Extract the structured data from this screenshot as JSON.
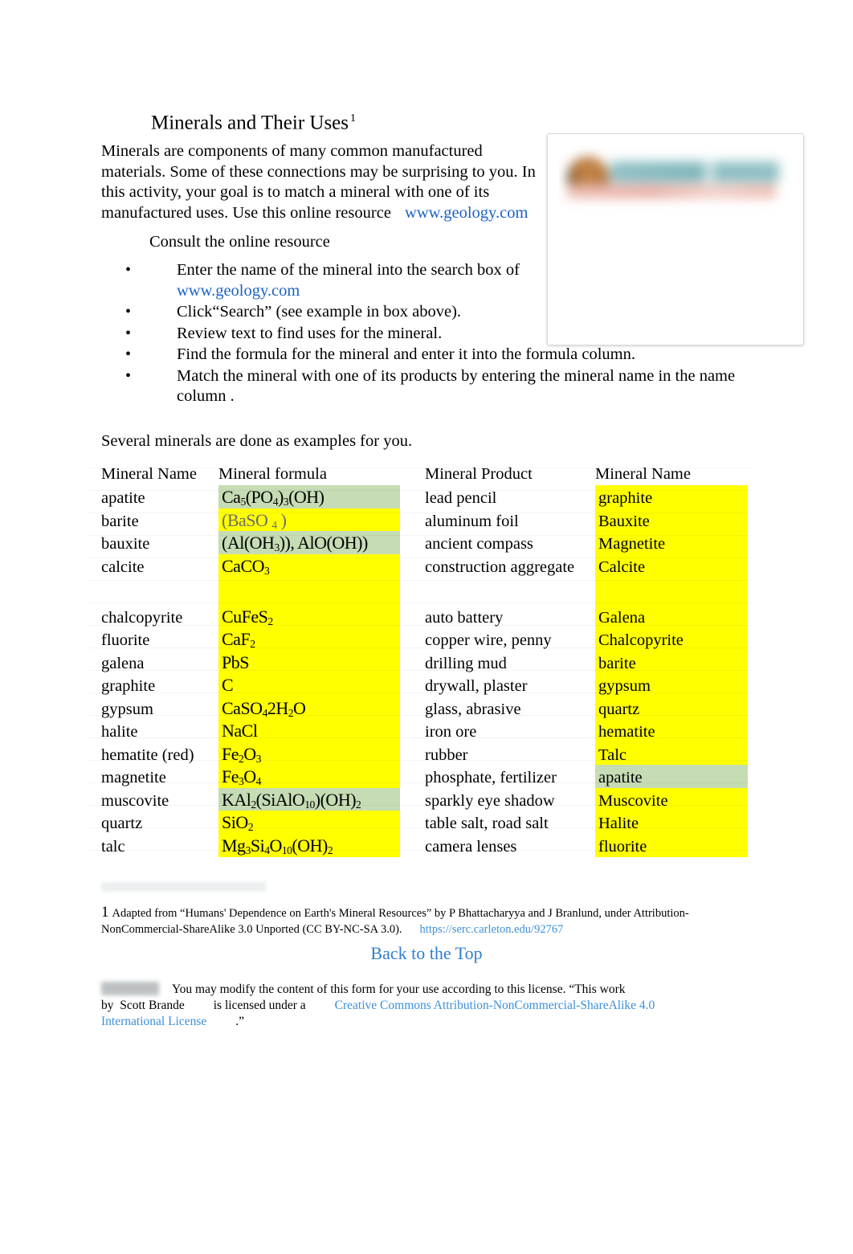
{
  "document": {
    "title": "Minerals and Their Uses",
    "title_footnote_marker": "1",
    "intro": "Minerals are components of many common manufactured materials. Some of these connections may be surprising to you. In this activity, your goal is to match a mineral with one of its manufactured uses. Use this online resource",
    "intro_link": "www.geology.com",
    "consult_heading": "Consult the online resource",
    "several_line": "Several minerals are done as examples for you."
  },
  "bullets": [
    {
      "text_before": "Enter the name of the mineral into the search box of",
      "link": "www.geology.com",
      "text_after": ""
    },
    {
      "text_before": "Click“Search” (see example in box above).",
      "link": "",
      "text_after": ""
    },
    {
      "text_before": "Review text to find uses for the mineral.",
      "link": "",
      "text_after": ""
    },
    {
      "text_before": "Find the formula for the mineral and enter it into the formula column.",
      "link": "",
      "text_after": ""
    },
    {
      "text_before": "Match the mineral with one of its products by entering the mineral name in the name column .",
      "link": "",
      "text_after": ""
    }
  ],
  "image_box": {
    "alt": "geology-com-website-screenshot",
    "logo_text": "Geology.com"
  },
  "table": {
    "headers": {
      "mineral_name": "Mineral Name",
      "mineral_formula": "Mineral formula",
      "mineral_product": "Mineral Product",
      "mineral_name_2": "Mineral Name"
    },
    "left_rows": [
      {
        "name": "apatite",
        "formula_html": "Ca<sub>5</sub>(PO<sub>4</sub>)<sub>3</sub>(OH)",
        "formula_text": "Ca5(PO4)3(OH)",
        "highlight": "green"
      },
      {
        "name": "barite",
        "formula_html": "(BaSO <sub>4</sub> )",
        "formula_text": "(BaSO 4 )",
        "highlight": "yellow",
        "faint": true
      },
      {
        "name": "bauxite",
        "formula_html": "(Al(OH<sub>3</sub>)), AlO(OH))",
        "formula_text": "(Al(OH3)), AlO(OH))",
        "highlight": "green"
      },
      {
        "name": "calcite",
        "formula_html": "CaCO<sub>3</sub>",
        "formula_text": "CaCO3",
        "highlight": "yellow"
      },
      {
        "name": "chalcopyrite",
        "formula_html": "CuFeS<sub>2</sub>",
        "formula_text": "CuFeS2",
        "highlight": "yellow"
      },
      {
        "name": "fluorite",
        "formula_html": "CaF<sub>2</sub>",
        "formula_text": "CaF2",
        "highlight": "yellow"
      },
      {
        "name": "galena",
        "formula_html": "PbS",
        "formula_text": "PbS",
        "highlight": "yellow"
      },
      {
        "name": "graphite",
        "formula_html": "C",
        "formula_text": "C",
        "highlight": "yellow"
      },
      {
        "name": "gypsum",
        "formula_html": "CaSO<sub>4</sub>2H<sub>2</sub>O",
        "formula_text": "CaSO42H2O",
        "highlight": "yellow"
      },
      {
        "name": "halite",
        "formula_html": "NaCl",
        "formula_text": "NaCl",
        "highlight": "yellow"
      },
      {
        "name": "hematite (red)",
        "formula_html": "Fe<sub>2</sub>O<sub>3</sub>",
        "formula_text": "Fe2O3",
        "highlight": "yellow"
      },
      {
        "name": "magnetite",
        "formula_html": "Fe<sub>3</sub>O<sub>4</sub>",
        "formula_text": "Fe3O4",
        "highlight": "yellow"
      },
      {
        "name": "muscovite",
        "formula_html": "KAl<sub>2</sub>(SiAlO<sub>10</sub>)(OH)<sub>2</sub>",
        "formula_text": "KAl2(SiAlO10)(OH)2",
        "highlight": "green"
      },
      {
        "name": "quartz",
        "formula_html": "SiO<sub>2</sub>",
        "formula_text": "SiO2",
        "highlight": "yellow"
      },
      {
        "name": "talc",
        "formula_html": "Mg<sub>3</sub>Si<sub>4</sub>O<sub>10</sub>(OH)<sub>2</sub>",
        "formula_text": "Mg3Si4O10(OH)2",
        "highlight": "yellow"
      }
    ],
    "right_rows": [
      {
        "product": "lead pencil",
        "name": "graphite",
        "highlight": "yellow"
      },
      {
        "product": "aluminum foil",
        "name": "Bauxite",
        "highlight": "yellow"
      },
      {
        "product": "ancient compass",
        "name": "Magnetite",
        "highlight": "yellow"
      },
      {
        "product": "construction aggregate",
        "name": "Calcite",
        "highlight": "yellow"
      },
      {
        "product": "auto battery",
        "name": "Galena",
        "highlight": "yellow"
      },
      {
        "product": "copper wire, penny",
        "name": "Chalcopyrite",
        "highlight": "yellow"
      },
      {
        "product": "drilling mud",
        "name": "barite",
        "highlight": "yellow"
      },
      {
        "product": "drywall, plaster",
        "name": "gypsum",
        "highlight": "yellow"
      },
      {
        "product": "glass, abrasive",
        "name": "quartz",
        "highlight": "yellow"
      },
      {
        "product": "iron ore",
        "name": "hematite",
        "highlight": "yellow"
      },
      {
        "product": "rubber",
        "name": "Talc",
        "highlight": "yellow"
      },
      {
        "product": "phosphate, fertilizer",
        "name": "apatite",
        "highlight": "green"
      },
      {
        "product": "sparkly eye shadow",
        "name": "Muscovite",
        "highlight": "yellow"
      },
      {
        "product": "table salt, road salt",
        "name": "Halite",
        "highlight": "yellow"
      },
      {
        "product": "camera lenses",
        "name": "fluorite",
        "highlight": "yellow"
      }
    ]
  },
  "footnote": {
    "number": "1",
    "text": "Adapted from “Humans' Dependence on Earth's Mineral Resources” by P Bhattacharyya and J Branlund, under Attribution-NonCommercial-ShareAlike 3.0 Unported (CC BY-NC-SA 3.0).",
    "link": "https://serc.carleton.edu/92767"
  },
  "back_to_top": "Back to the Top",
  "license": {
    "line1": "You may modify the content of this form for your use according to this license. “This work",
    "by_label": "by",
    "author": "Scott Brande",
    "mid": "is licensed under a",
    "link_part1": "Creative Commons Attribution-NonCommercial-ShareAlike 4.0",
    "link_part2": "International License",
    "closing": ".”"
  },
  "colors": {
    "highlight_yellow": "#ffff00",
    "highlight_green": "#c6dcb4",
    "link_blue": "#1b62c4",
    "link_light_blue": "#3d8fd8"
  }
}
